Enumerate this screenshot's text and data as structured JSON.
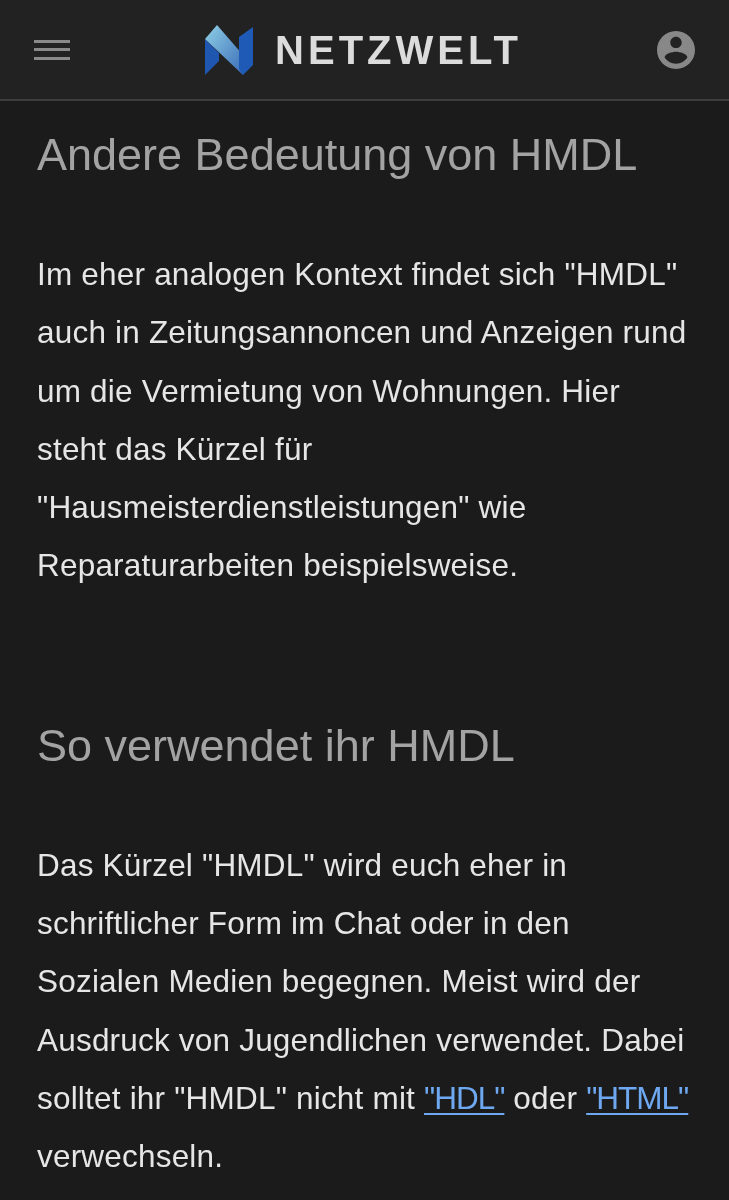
{
  "header": {
    "brand": "NETZWELT"
  },
  "sections": [
    {
      "heading": "Andere Bedeutung von HMDL",
      "paragraph": [
        {
          "kind": "text",
          "text": "Im eher analogen Kontext findet sich \"HMDL\" auch in Zeitungsannoncen und Anzeigen rund um die Vermietung von Wohnungen. Hier steht das Kürzel für \"Hausmeisterdienstleistungen\" wie Reparaturarbeiten beispielsweise."
        }
      ]
    },
    {
      "heading": "So verwendet ihr HMDL",
      "paragraph": [
        {
          "kind": "text",
          "text": "Das Kürzel \"HMDL\" wird euch eher in schriftlicher Form im Chat oder in den Sozialen Medien begegnen. Meist wird der Ausdruck von Jugendlichen verwendet. Dabei solltet ihr \"HMDL\" nicht mit "
        },
        {
          "kind": "link",
          "text": "\"HDL\""
        },
        {
          "kind": "text",
          "text": " oder "
        },
        {
          "kind": "link",
          "text": "\"HTML\""
        },
        {
          "kind": "text",
          "text": " verwechseln."
        }
      ]
    }
  ]
}
